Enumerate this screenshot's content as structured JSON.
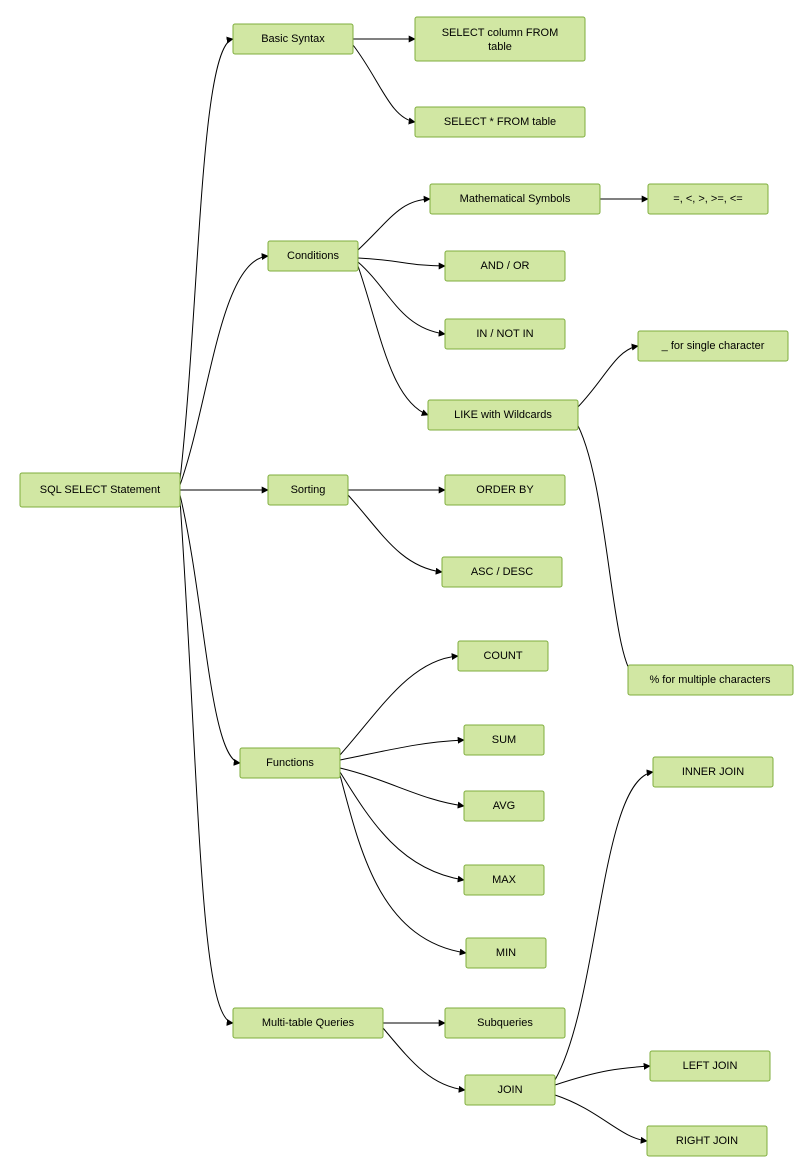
{
  "nodes": {
    "root": "SQL SELECT Statement",
    "basic_syntax": "Basic Syntax",
    "select_col": "SELECT column FROM table",
    "select_star": "SELECT * FROM table",
    "conditions": "Conditions",
    "math_sym": "Mathematical Symbols",
    "sym_list": "=, <, >, >=, <=",
    "and_or": "AND / OR",
    "in_notin": "IN / NOT IN",
    "like": "LIKE with Wildcards",
    "underscore": "_ for single character",
    "percent": "% for multiple characters",
    "sorting": "Sorting",
    "orderby": "ORDER BY",
    "ascdesc": "ASC / DESC",
    "functions": "Functions",
    "count": "COUNT",
    "sum": "SUM",
    "avg": "AVG",
    "max": "MAX",
    "min": "MIN",
    "multi": "Multi-table Queries",
    "subq": "Subqueries",
    "join": "JOIN",
    "inner": "INNER JOIN",
    "left": "LEFT JOIN",
    "right": "RIGHT JOIN"
  },
  "chart_data": {
    "type": "tree-diagram",
    "root": "SQL SELECT Statement",
    "children": [
      {
        "label": "Basic Syntax",
        "children": [
          {
            "label": "SELECT column FROM table"
          },
          {
            "label": "SELECT * FROM table"
          }
        ]
      },
      {
        "label": "Conditions",
        "children": [
          {
            "label": "Mathematical Symbols",
            "children": [
              {
                "label": "=, <, >, >=, <="
              }
            ]
          },
          {
            "label": "AND / OR"
          },
          {
            "label": "IN / NOT IN"
          },
          {
            "label": "LIKE with Wildcards",
            "children": [
              {
                "label": "_ for single character"
              },
              {
                "label": "% for multiple characters"
              }
            ]
          }
        ]
      },
      {
        "label": "Sorting",
        "children": [
          {
            "label": "ORDER BY"
          },
          {
            "label": "ASC / DESC"
          }
        ]
      },
      {
        "label": "Functions",
        "children": [
          {
            "label": "COUNT"
          },
          {
            "label": "SUM"
          },
          {
            "label": "AVG"
          },
          {
            "label": "MAX"
          },
          {
            "label": "MIN"
          }
        ]
      },
      {
        "label": "Multi-table Queries",
        "children": [
          {
            "label": "Subqueries"
          },
          {
            "label": "JOIN",
            "children": [
              {
                "label": "INNER JOIN"
              },
              {
                "label": "LEFT JOIN"
              },
              {
                "label": "RIGHT JOIN"
              }
            ]
          }
        ]
      }
    ]
  }
}
